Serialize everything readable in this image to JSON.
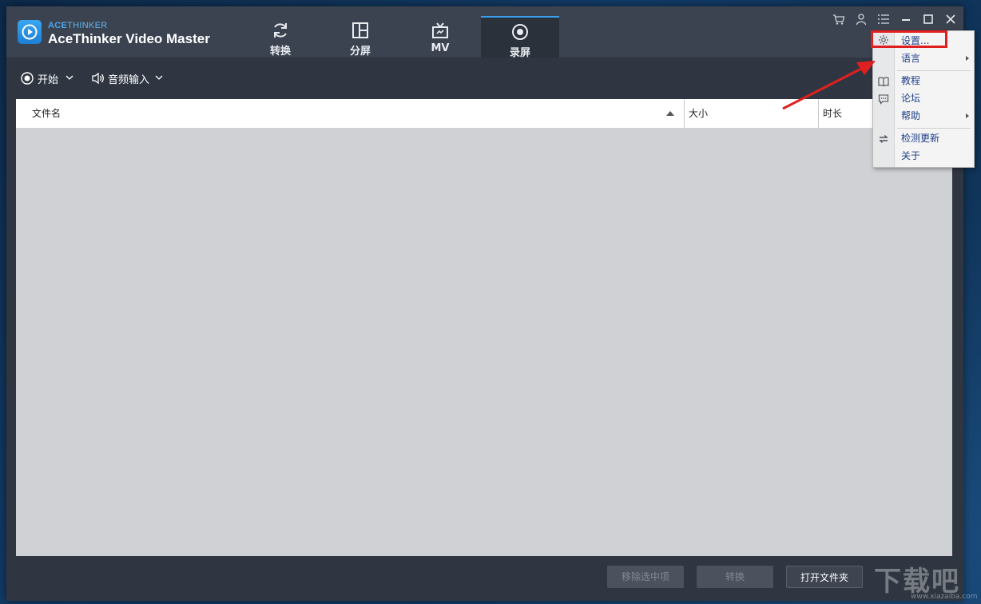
{
  "app": {
    "brand_top_bold": "ACE",
    "brand_top_thin": "THINKER",
    "title": "AceThinker Video Master"
  },
  "tabs": [
    {
      "label": "转换",
      "icon": "refresh-icon"
    },
    {
      "label": "分屏",
      "icon": "split-screen-icon"
    },
    {
      "label": "MV",
      "icon": "tv-icon"
    },
    {
      "label": "录屏",
      "icon": "record-icon",
      "active": true
    }
  ],
  "toolbar": {
    "start_label": "开始",
    "audio_label": "音频输入"
  },
  "file_list": {
    "columns": [
      "文件名",
      "大小",
      "时长"
    ],
    "rows": []
  },
  "footer": {
    "remove_selected": "移除选中项",
    "convert": "转换",
    "open_folder": "打开文件夹"
  },
  "menu": {
    "items": [
      {
        "label": "设置...",
        "icon": "gear-icon"
      },
      {
        "label": "语言",
        "submenu": true
      },
      {
        "label": "教程",
        "icon": "book-icon"
      },
      {
        "label": "论坛",
        "icon": "chat-icon"
      },
      {
        "label": "帮助",
        "submenu": true
      },
      {
        "label": "检测更新",
        "icon": "update-icon"
      },
      {
        "label": "关于"
      }
    ]
  },
  "colors": {
    "accent": "#39a0f0",
    "highlight": "#e02020",
    "menu_text": "#1f3f8a"
  },
  "watermark": {
    "text": "下载吧",
    "url_text": "www.xiazaiba.com"
  }
}
